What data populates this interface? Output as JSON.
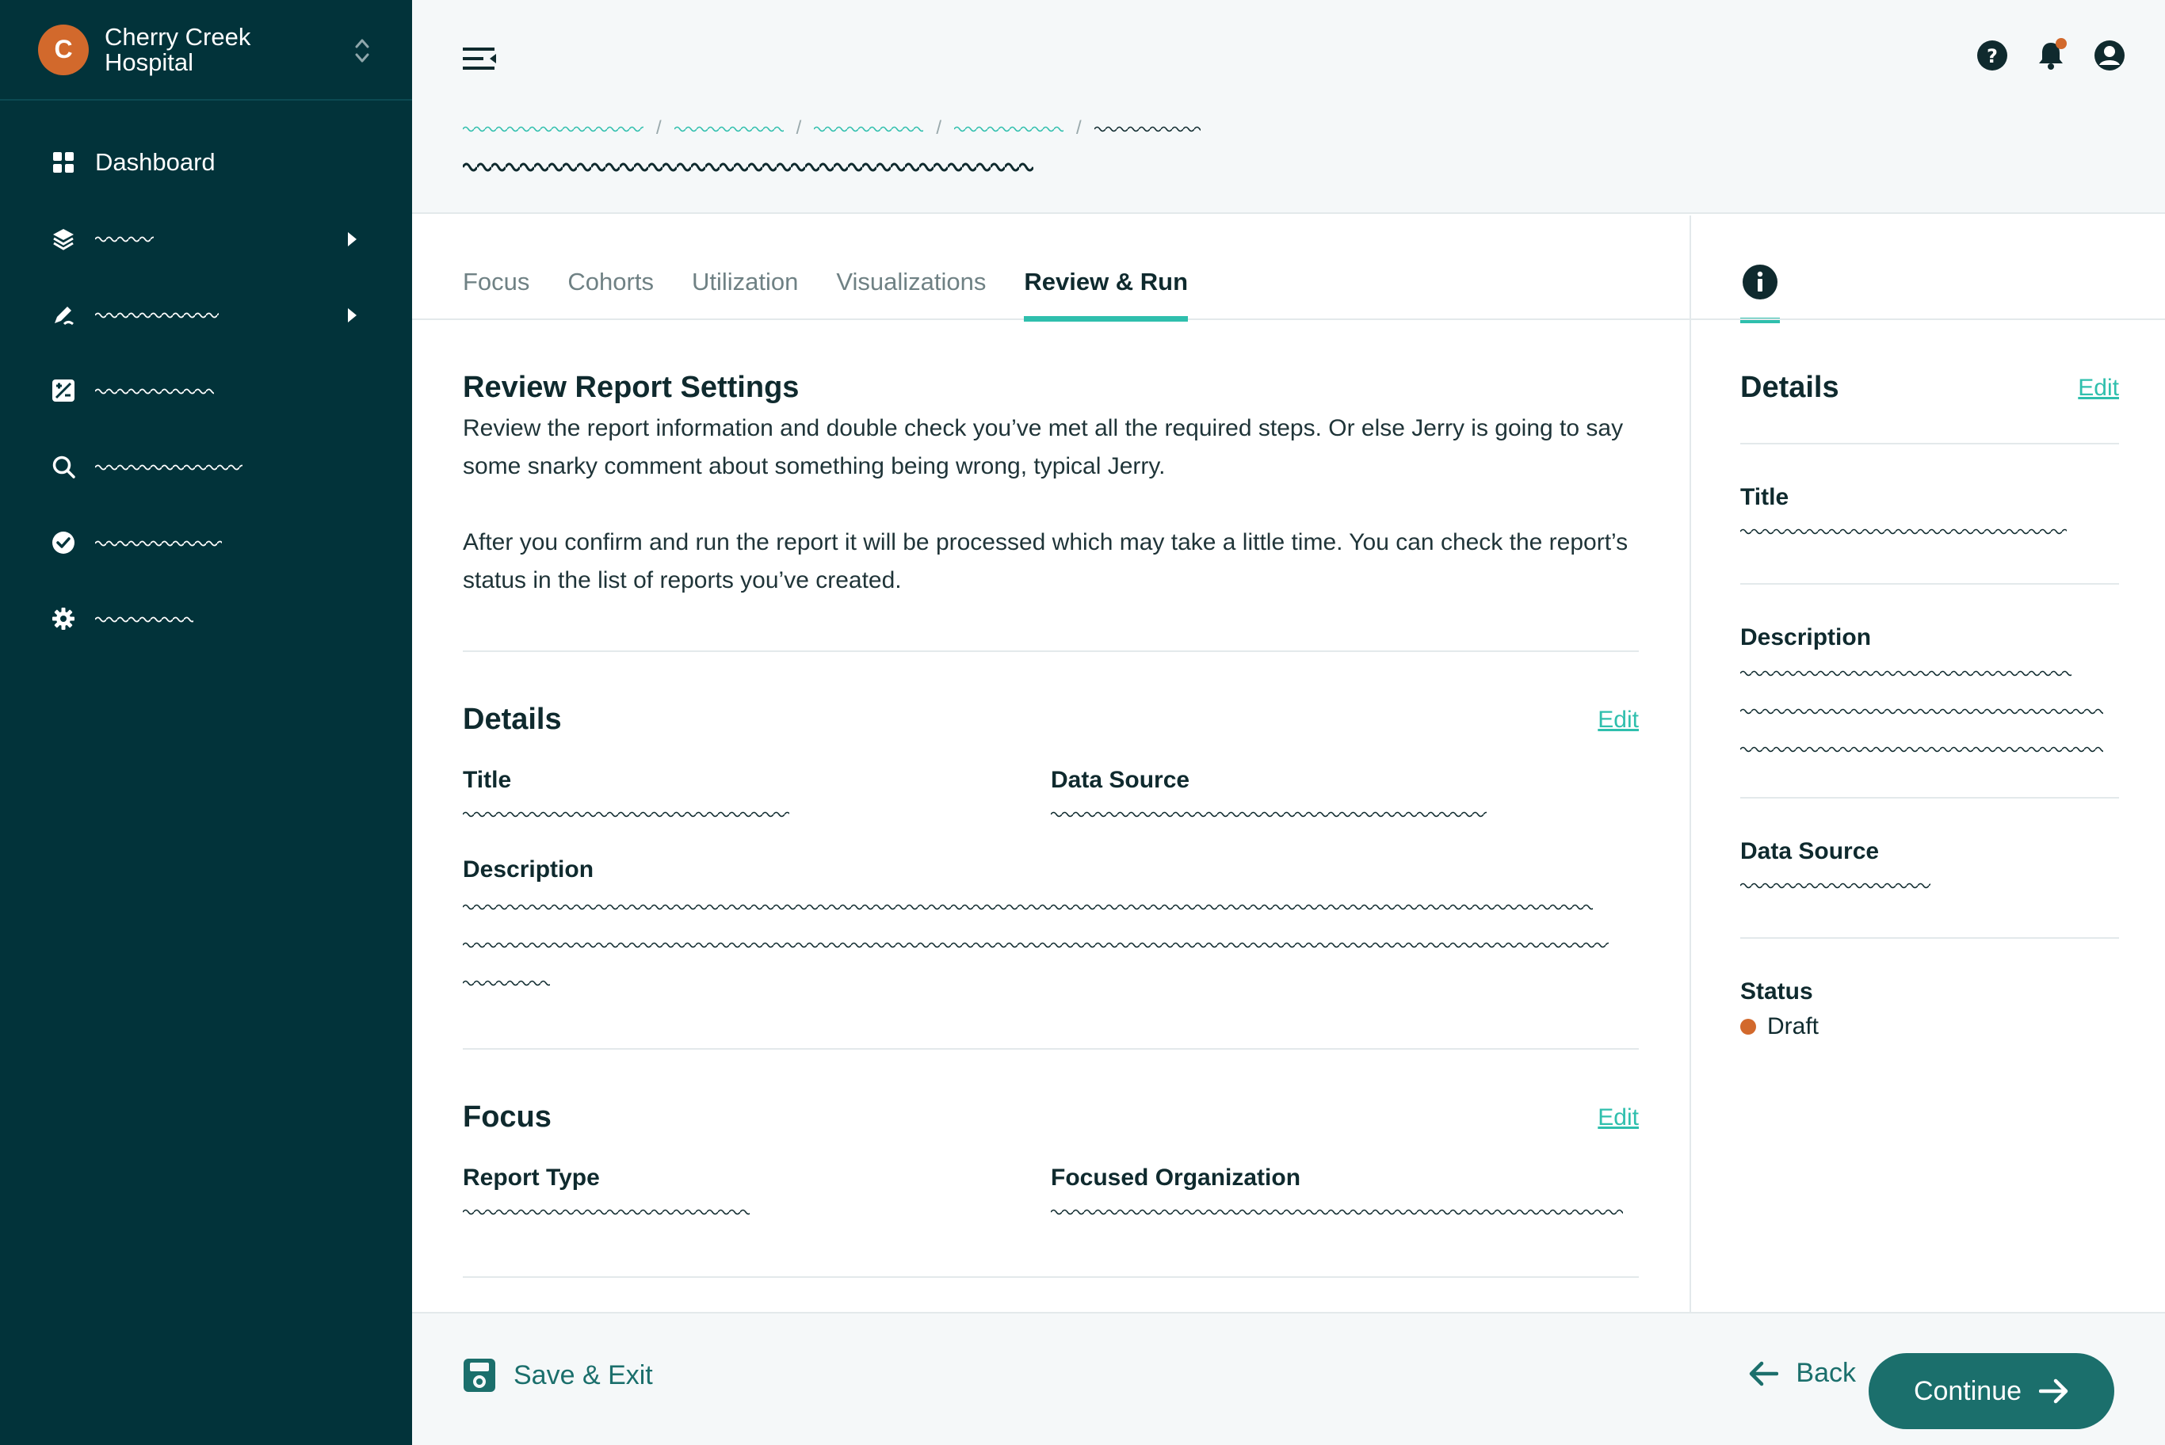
{
  "sidebar": {
    "org_initial": "C",
    "org_name": "Cherry Creek Hospital",
    "items": [
      {
        "label": "Dashboard",
        "icon": "dashboard-grid-icon"
      },
      {
        "label": "",
        "icon": "layers-icon",
        "has_submenu": true
      },
      {
        "label": "",
        "icon": "pen-icon",
        "has_submenu": true
      },
      {
        "label": "",
        "icon": "calc-icon"
      },
      {
        "label": "",
        "icon": "search-icon"
      },
      {
        "label": "",
        "icon": "check-circle-icon"
      },
      {
        "label": "",
        "icon": "gear-icon"
      }
    ]
  },
  "tabs": [
    "Focus",
    "Cohorts",
    "Utilization",
    "Visualizations",
    "Review & Run"
  ],
  "active_tab": "Review & Run",
  "review": {
    "title": "Review Report Settings",
    "para1": "Review the report information and double check you’ve met all the required steps. Or else Jerry is going to say some snarky comment about something being wrong, typical Jerry.",
    "para2": "After you confirm and run the report it will be processed which may take a little time. You can check the report’s status in the list of reports you’ve created."
  },
  "details": {
    "heading": "Details",
    "edit": "Edit",
    "title_label": "Title",
    "data_source_label": "Data Source",
    "description_label": "Description"
  },
  "focus": {
    "heading": "Focus",
    "edit": "Edit",
    "report_type_label": "Report Type",
    "focused_org_label": "Focused Organization"
  },
  "panel": {
    "heading": "Details",
    "edit": "Edit",
    "title_label": "Title",
    "description_label": "Description",
    "data_source_label": "Data Source",
    "status_label": "Status",
    "status_value": "Draft"
  },
  "footer": {
    "save_exit": "Save & Exit",
    "back": "Back",
    "continue": "Continue"
  },
  "colors": {
    "sidebar_bg": "#02333a",
    "accent": "#2fbfad",
    "primary": "#1b6f6c",
    "status_draft": "#d2692c"
  }
}
